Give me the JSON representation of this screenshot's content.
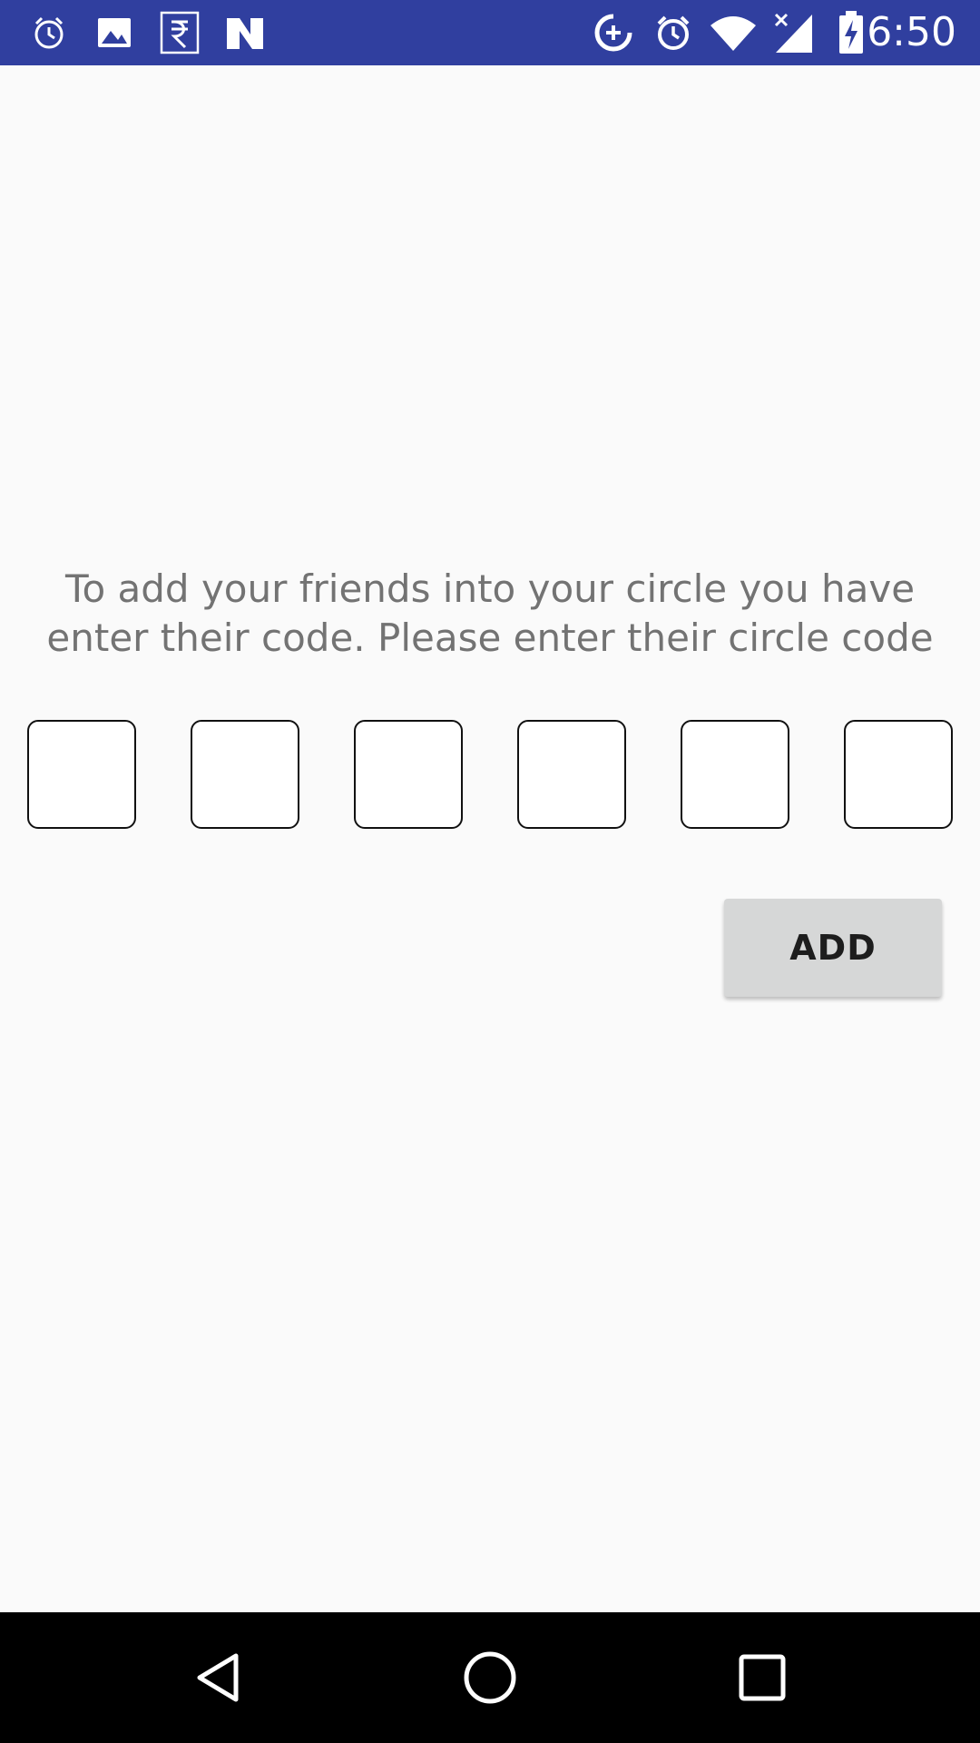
{
  "status_bar": {
    "time": "6:50",
    "left_icons": [
      "alarm-icon",
      "image-icon",
      "rupee-icon",
      "n-logo-icon"
    ],
    "right_icons": [
      "data-saver-icon",
      "alarm-icon",
      "wifi-icon",
      "signal-icon",
      "battery-charging-icon"
    ],
    "background_color": "#303f9f"
  },
  "main": {
    "instruction": "To add your friends into your circle you have enter their code. Please enter their circle code",
    "code_inputs": [
      "",
      "",
      "",
      "",
      "",
      ""
    ],
    "add_button_label": "ADD"
  },
  "nav_bar": {
    "buttons": [
      "back-icon",
      "home-icon",
      "recents-icon"
    ]
  }
}
